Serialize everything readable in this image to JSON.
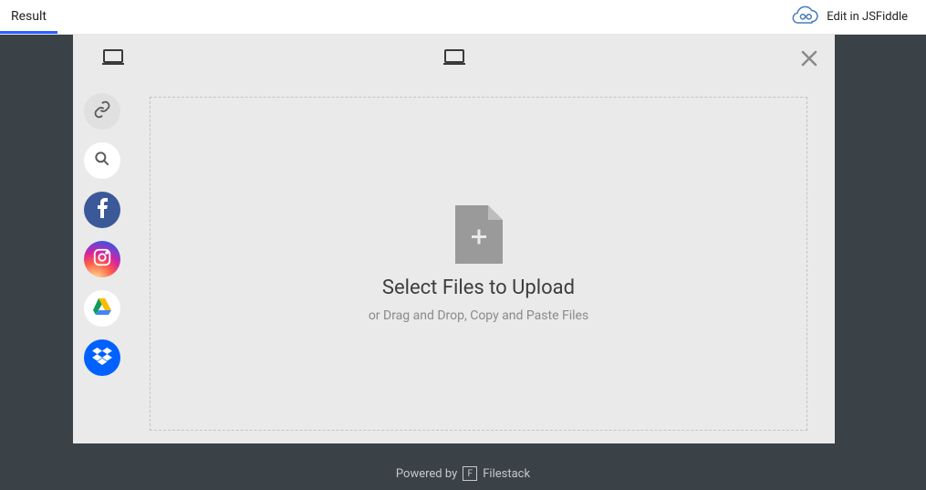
{
  "topbar": {
    "tab_label": "Result",
    "edit_label": "Edit in JSFiddle"
  },
  "modal": {
    "sources": {
      "link": "link-icon",
      "search": "search-icon",
      "facebook": "facebook-icon",
      "instagram": "instagram-icon",
      "gdrive": "gdrive-icon",
      "dropbox": "dropbox-icon"
    },
    "drop": {
      "title": "Select Files to Upload",
      "subtitle": "or Drag and Drop, Copy and Paste Files"
    }
  },
  "footer": {
    "powered_by": "Powered by",
    "brand": "Filestack"
  }
}
